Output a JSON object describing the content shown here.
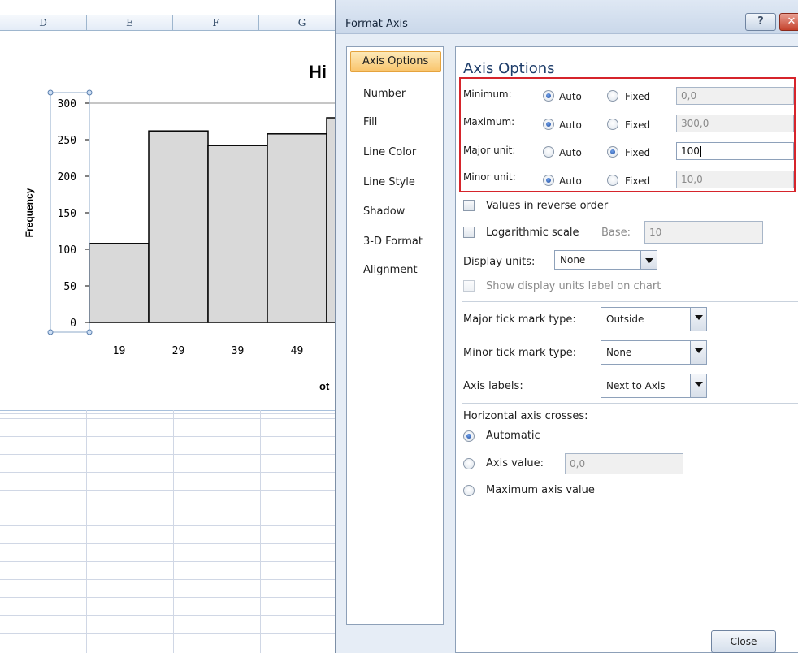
{
  "sheet": {
    "columns": [
      "D",
      "E",
      "F",
      "G"
    ]
  },
  "chart_data": {
    "type": "bar",
    "title": "Hi",
    "ylabel": "Frequency",
    "xlabel": "ot",
    "categories": [
      "19",
      "29",
      "39",
      "49"
    ],
    "values": [
      108,
      262,
      242,
      258,
      280
    ],
    "yticks": [
      0,
      50,
      100,
      150,
      200,
      250,
      300
    ],
    "ytick_labels": [
      "0",
      "50",
      "100",
      "150",
      "200",
      "250",
      "300"
    ],
    "ylim": [
      0,
      300
    ],
    "bar_color": "#d9d9d9"
  },
  "dialog": {
    "title": "Format Axis",
    "help_label": "?",
    "close_x_label": "✕",
    "nav": [
      "Axis Options",
      "Number",
      "Fill",
      "Line Color",
      "Line Style",
      "Shadow",
      "3-D Format",
      "Alignment"
    ],
    "panel_title": "Axis Options",
    "rows": [
      {
        "label": "Minimum:",
        "auto_label": "Auto",
        "fixed_label": "Fixed",
        "selected": "auto",
        "value": "0,0"
      },
      {
        "label": "Maximum:",
        "auto_label": "Auto",
        "fixed_label": "Fixed",
        "selected": "auto",
        "value": "300,0"
      },
      {
        "label": "Major unit:",
        "auto_label": "Auto",
        "fixed_label": "Fixed",
        "selected": "fixed",
        "value": "100"
      },
      {
        "label": "Minor unit:",
        "auto_label": "Auto",
        "fixed_label": "Fixed",
        "selected": "auto",
        "value": "10,0"
      }
    ],
    "reverse_order_label": "Values in reverse order",
    "log_scale_label": "Logarithmic scale",
    "base_label": "Base:",
    "base_value": "10",
    "display_units_label": "Display units:",
    "display_units_value": "None",
    "show_units_label": "Show display units label on chart",
    "major_tick_label": "Major tick mark type:",
    "major_tick_value": "Outside",
    "minor_tick_label": "Minor tick mark type:",
    "minor_tick_value": "None",
    "axis_labels_label": "Axis labels:",
    "axis_labels_value": "Next to Axis",
    "crosses_heading": "Horizontal axis crosses:",
    "cross_automatic": "Automatic",
    "cross_axis_value": "Axis value:",
    "cross_axis_value_field": "0,0",
    "cross_max": "Maximum axis value",
    "close_button": "Close"
  }
}
